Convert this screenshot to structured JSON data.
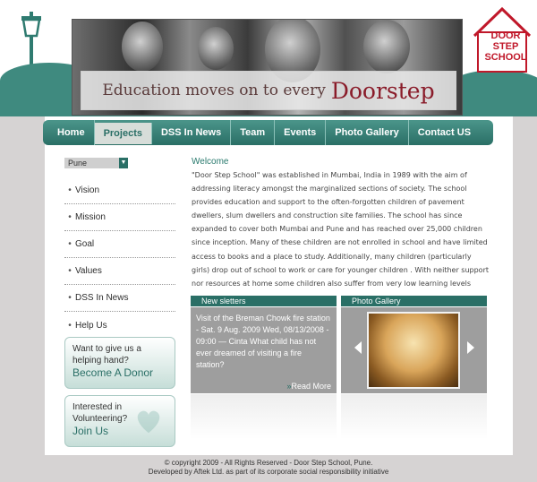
{
  "header": {
    "tagline_small": "Education moves on to every",
    "tagline_big": "Doorstep",
    "logo_lines": [
      "DOOR",
      "STEP",
      "SCHOOL"
    ],
    "brand_color": "#c0182a",
    "accent_color": "#2a6f66"
  },
  "nav": {
    "items": [
      "Home",
      "Projects",
      "DSS In News",
      "Team",
      "Events",
      "Photo Gallery",
      "Contact US"
    ],
    "active": "Projects"
  },
  "sidebar": {
    "city_selected": "Pune",
    "items": [
      "Vision",
      "Mission",
      "Goal",
      "Values",
      "DSS In News",
      "Help Us"
    ],
    "donor": {
      "line1": "Want to give us a",
      "line2": "helping hand?",
      "action": "Become A Donor"
    },
    "volunteer": {
      "line1": "Interested in",
      "line2": "Volunteering?",
      "action": "Join Us"
    }
  },
  "main": {
    "welcome_title": "Welcome",
    "intro": "\"Door Step School\" was established in Mumbai, India in 1989 with the aim of addressing literacy amongst the marginalized sections of society. The school provides education and support to the often-forgotten children of pavement dwellers, slum dwellers and construction site families. The school has since expanded to cover both Mumbai and Pune and has reached over 25,000 children since inception. Many of these children are not enrolled in school and have limited access to books and a place to study. Additionally, many children (particularly girls) drop out of school to work or care for younger children . With neither support nor resources at home some children also suffer from very low learning levels",
    "newsletter": {
      "heading": "New sletters",
      "body": "Visit of the Breman Chowk fire station - Sat. 9 Aug. 2009 Wed, 08/13/2008 - 09:00 — Cinta What child has not ever dreamed of visiting a fire station?",
      "read_more": "Read More"
    },
    "gallery": {
      "heading": "Photo Gallery"
    }
  },
  "footer": {
    "line1": "© copyright 2009 - All Rights Reserved - Door Step School, Pune.",
    "line2": "Developed by Aftek Ltd. as part of its corporate social responsibility initiative"
  }
}
